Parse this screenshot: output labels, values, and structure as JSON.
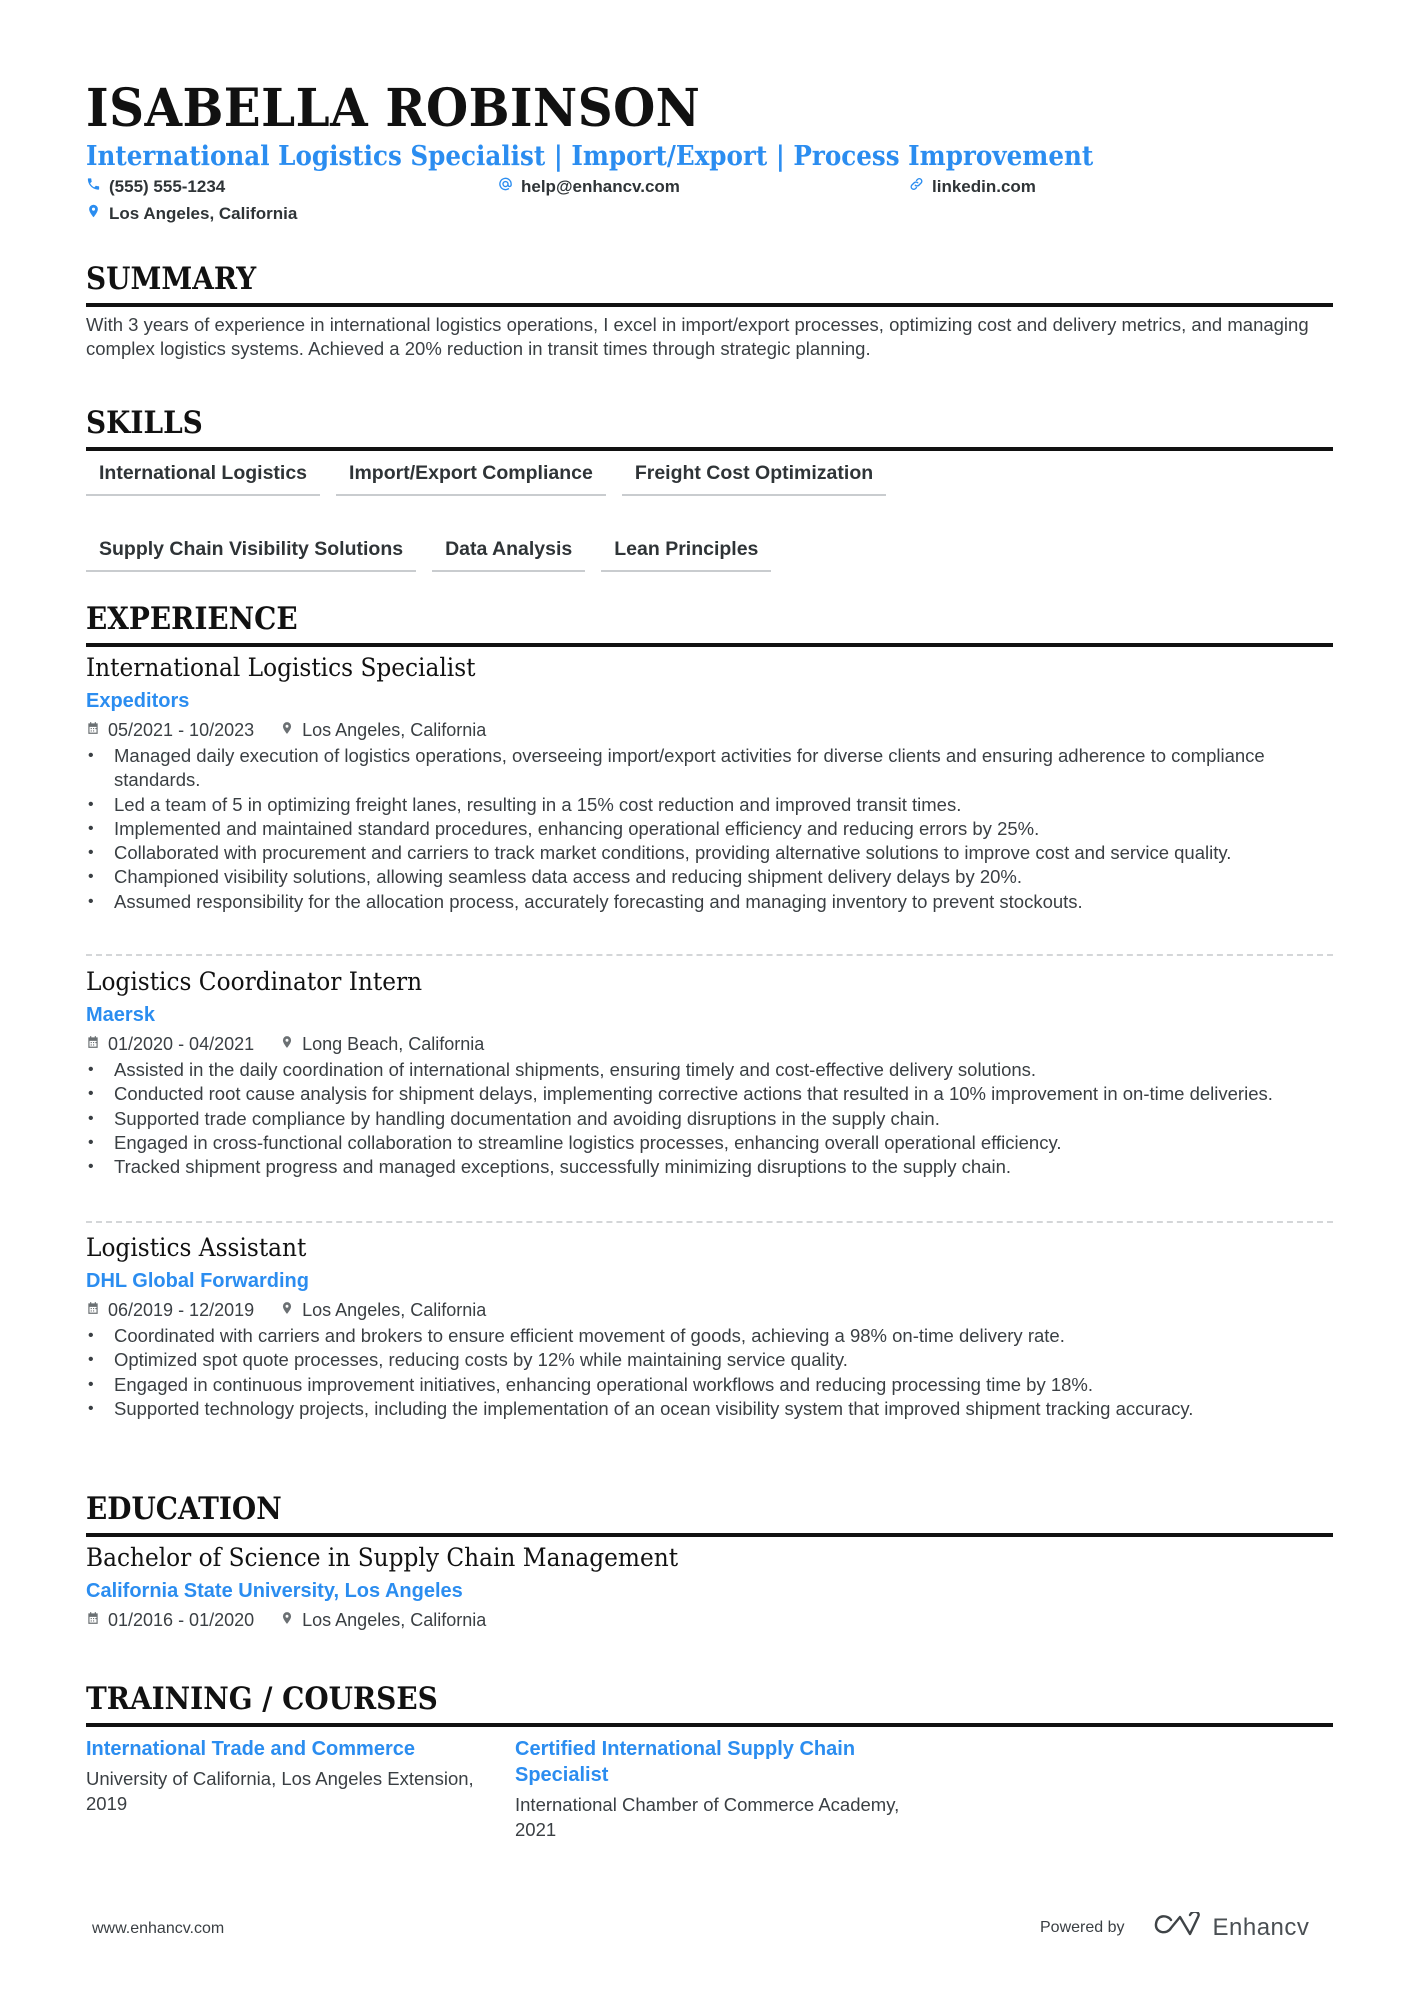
{
  "header": {
    "name": "ISABELLA ROBINSON",
    "title": "International Logistics Specialist | Import/Export | Process Improvement",
    "phone": "(555) 555-1234",
    "email": "help@enhancv.com",
    "linkedin": "linkedin.com",
    "location": "Los Angeles, California",
    "icons": {
      "phone": "phone-icon",
      "email": "at-icon",
      "linkedin": "link-icon",
      "location": "location-pin-icon"
    }
  },
  "summary": {
    "heading": "SUMMARY",
    "text": "With 3 years of experience in international logistics operations, I excel in import/export processes, optimizing cost and delivery metrics, and managing complex logistics systems. Achieved a 20% reduction in transit times through strategic planning."
  },
  "skills": {
    "heading": "SKILLS",
    "items": [
      "International Logistics",
      "Import/Export Compliance",
      "Freight Cost Optimization",
      "Supply Chain Visibility Solutions",
      "Data Analysis",
      "Lean Principles"
    ]
  },
  "experience": {
    "heading": "EXPERIENCE",
    "jobs": [
      {
        "title": "International Logistics Specialist",
        "company": "Expeditors",
        "dates": "05/2021 - 10/2023",
        "location": "Los Angeles, California",
        "bullets": [
          "Managed daily execution of logistics operations, overseeing import/export activities for diverse clients and ensuring adherence to compliance standards.",
          "Led a team of 5 in optimizing freight lanes, resulting in a 15% cost reduction and improved transit times.",
          "Implemented and maintained standard procedures, enhancing operational efficiency and reducing errors by 25%.",
          "Collaborated with procurement and carriers to track market conditions, providing alternative solutions to improve cost and service quality.",
          "Championed visibility solutions, allowing seamless data access and reducing shipment delivery delays by 20%.",
          "Assumed responsibility for the allocation process, accurately forecasting and managing inventory to prevent stockouts."
        ]
      },
      {
        "title": "Logistics Coordinator Intern",
        "company": "Maersk",
        "dates": "01/2020 - 04/2021",
        "location": "Long Beach, California",
        "bullets": [
          "Assisted in the daily coordination of international shipments, ensuring timely and cost-effective delivery solutions.",
          "Conducted root cause analysis for shipment delays, implementing corrective actions that resulted in a 10% improvement in on-time deliveries.",
          "Supported trade compliance by handling documentation and avoiding disruptions in the supply chain.",
          "Engaged in cross-functional collaboration to streamline logistics processes, enhancing overall operational efficiency.",
          "Tracked shipment progress and managed exceptions, successfully minimizing disruptions to the supply chain."
        ]
      },
      {
        "title": "Logistics Assistant",
        "company": "DHL Global Forwarding",
        "dates": "06/2019 - 12/2019",
        "location": "Los Angeles, California",
        "bullets": [
          "Coordinated with carriers and brokers to ensure efficient movement of goods, achieving a 98% on-time delivery rate.",
          "Optimized spot quote processes, reducing costs by 12% while maintaining service quality.",
          "Engaged in continuous improvement initiatives, enhancing operational workflows and reducing processing time by 18%.",
          "Supported technology projects, including the implementation of an ocean visibility system that improved shipment tracking accuracy."
        ]
      }
    ]
  },
  "education": {
    "heading": "EDUCATION",
    "degree": "Bachelor of Science in Supply Chain Management",
    "school": "California State University, Los Angeles",
    "dates": "01/2016 - 01/2020",
    "location": "Los Angeles, California"
  },
  "training": {
    "heading": "TRAINING / COURSES",
    "courses": [
      {
        "title": "International Trade and Commerce",
        "description": "University of California, Los Angeles Extension, 2019"
      },
      {
        "title": "Certified International Supply Chain Specialist",
        "description": "International Chamber of Commerce Academy, 2021"
      }
    ]
  },
  "footer": {
    "website": "www.enhancv.com",
    "powered_by": "Powered by",
    "brand": "Enhancv"
  },
  "colors": {
    "accent": "#2b8df0",
    "heading": "#111111",
    "body_text": "#3a3f43"
  }
}
